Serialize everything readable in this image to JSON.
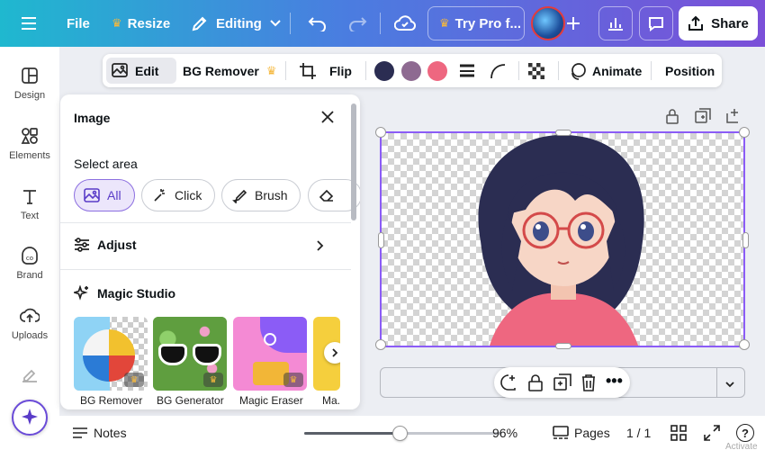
{
  "topbar": {
    "file_label": "File",
    "resize_label": "Resize",
    "editing_label": "Editing",
    "trypro_label": "Try Pro f...",
    "share_label": "Share"
  },
  "rail": {
    "items": [
      {
        "label": "Design",
        "icon": "layout-icon"
      },
      {
        "label": "Elements",
        "icon": "shapes-icon"
      },
      {
        "label": "Text",
        "icon": "text-icon"
      },
      {
        "label": "Brand",
        "icon": "brand-icon"
      },
      {
        "label": "Uploads",
        "icon": "cloud-upload-icon"
      }
    ]
  },
  "context_toolbar": {
    "edit_label": "Edit",
    "bg_remover_label": "BG Remover",
    "flip_label": "Flip",
    "animate_label": "Animate",
    "position_label": "Position",
    "colors": [
      "#2b2d52",
      "#8e6a91",
      "#ee6780"
    ]
  },
  "panel": {
    "title": "Image",
    "select_area_label": "Select area",
    "chips": [
      "All",
      "Click",
      "Brush"
    ],
    "adjust_label": "Adjust",
    "magic_studio_label": "Magic Studio",
    "tiles": [
      "BG Remover",
      "BG Generator",
      "Magic Eraser",
      "Ma..."
    ]
  },
  "bottombar": {
    "notes_label": "Notes",
    "zoom_value": "96%",
    "zoom_fraction": 0.48,
    "pages_label": "Pages",
    "page_count": "1 / 1",
    "help_label": "?"
  },
  "watermark": "Activate"
}
